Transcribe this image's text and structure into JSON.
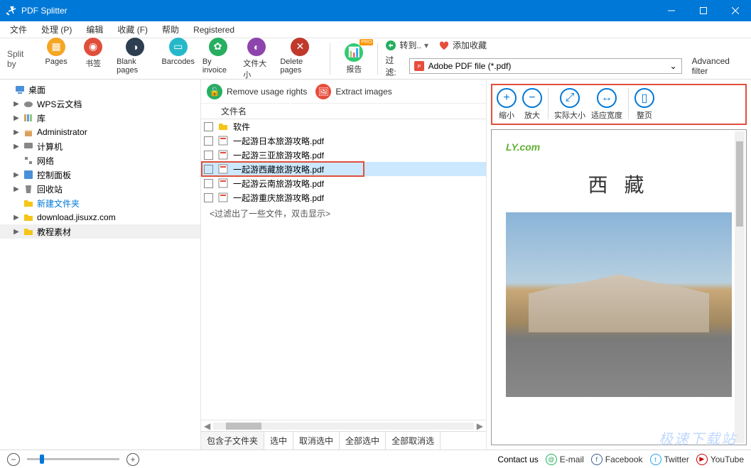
{
  "app": {
    "title": "PDF Splitter"
  },
  "menu": [
    "文件",
    "处理 (P)",
    "编辑",
    "收藏 (F)",
    "帮助",
    "Registered"
  ],
  "toolbar": {
    "splitby": "Split by",
    "buttons": [
      {
        "label": "Pages",
        "color": "orange",
        "glyph": "▦"
      },
      {
        "label": "书签",
        "color": "red",
        "glyph": "◉"
      },
      {
        "label": "Blank pages",
        "color": "navy",
        "glyph": "◑"
      },
      {
        "label": "Barcodes",
        "color": "teal",
        "glyph": "▭"
      },
      {
        "label": "By invoice",
        "color": "green",
        "glyph": "✿"
      },
      {
        "label": "文件大小",
        "color": "purple",
        "glyph": "◐"
      },
      {
        "label": "Delete pages",
        "color": "dred",
        "glyph": "✕"
      }
    ],
    "report": "报告",
    "pro": "PRO",
    "goto": "转到..",
    "addfav": "添加收藏",
    "filter_label": "过滤:",
    "filter_value": "Adobe PDF file (*.pdf)",
    "adv_filter": "Advanced filter"
  },
  "tree": [
    {
      "label": "桌面",
      "icon": "desktop",
      "arrow": "",
      "level": 0,
      "blue": false
    },
    {
      "label": "WPS云文档",
      "icon": "cloud",
      "arrow": "▶",
      "level": 1,
      "blue": false
    },
    {
      "label": "库",
      "icon": "lib",
      "arrow": "▶",
      "level": 1,
      "blue": false
    },
    {
      "label": "Administrator",
      "icon": "user",
      "arrow": "▶",
      "level": 1,
      "blue": false
    },
    {
      "label": "计算机",
      "icon": "pc",
      "arrow": "▶",
      "level": 1,
      "blue": false
    },
    {
      "label": "网络",
      "icon": "net",
      "arrow": "",
      "level": 1,
      "blue": false
    },
    {
      "label": "控制面板",
      "icon": "ctrl",
      "arrow": "▶",
      "level": 1,
      "blue": false
    },
    {
      "label": "回收站",
      "icon": "bin",
      "arrow": "▶",
      "level": 1,
      "blue": false
    },
    {
      "label": "新建文件夹",
      "icon": "folder",
      "arrow": "",
      "level": 1,
      "blue": true
    },
    {
      "label": "download.jisuxz.com",
      "icon": "folder",
      "arrow": "▶",
      "level": 1,
      "blue": false
    },
    {
      "label": "教程素材",
      "icon": "folder",
      "arrow": "▶",
      "level": 1,
      "blue": false,
      "sel": true
    }
  ],
  "center": {
    "remove_rights": "Remove usage rights",
    "extract_images": "Extract images",
    "col_name": "文件名",
    "files": [
      {
        "name": "软件",
        "type": "folder"
      },
      {
        "name": "一起游日本旅游攻略.pdf",
        "type": "pdf"
      },
      {
        "name": "一起游三亚旅游攻略.pdf",
        "type": "pdf"
      },
      {
        "name": "一起游西藏旅游攻略.pdf",
        "type": "pdf",
        "sel": true
      },
      {
        "name": "一起游云南旅游攻略.pdf",
        "type": "pdf"
      },
      {
        "name": "一起游重庆旅游攻略.pdf",
        "type": "pdf"
      }
    ],
    "filter_msg": "<过滤出了一些文件，双击显示>",
    "bottom": [
      "包含子文件夹",
      "选中",
      "取消选中",
      "全部选中",
      "全部取消选"
    ]
  },
  "zoom": [
    {
      "label": "缩小",
      "glyph": "+"
    },
    {
      "label": "放大",
      "glyph": "−"
    },
    {
      "label": "实际大小",
      "glyph": "⤢"
    },
    {
      "label": "适应宽度",
      "glyph": "↔"
    },
    {
      "label": "整页",
      "glyph": "▯"
    }
  ],
  "preview": {
    "logo": "LY.com",
    "title": "西 藏"
  },
  "status": {
    "contact": "Contact us",
    "social": [
      {
        "label": "E-mail",
        "color": "#27ae60",
        "g": "@"
      },
      {
        "label": "Facebook",
        "color": "#3b5998",
        "g": "f"
      },
      {
        "label": "Twitter",
        "color": "#1da1f2",
        "g": "t"
      },
      {
        "label": "YouTube",
        "color": "#cc0000",
        "g": "▶"
      }
    ]
  },
  "watermark": "极速下载站"
}
